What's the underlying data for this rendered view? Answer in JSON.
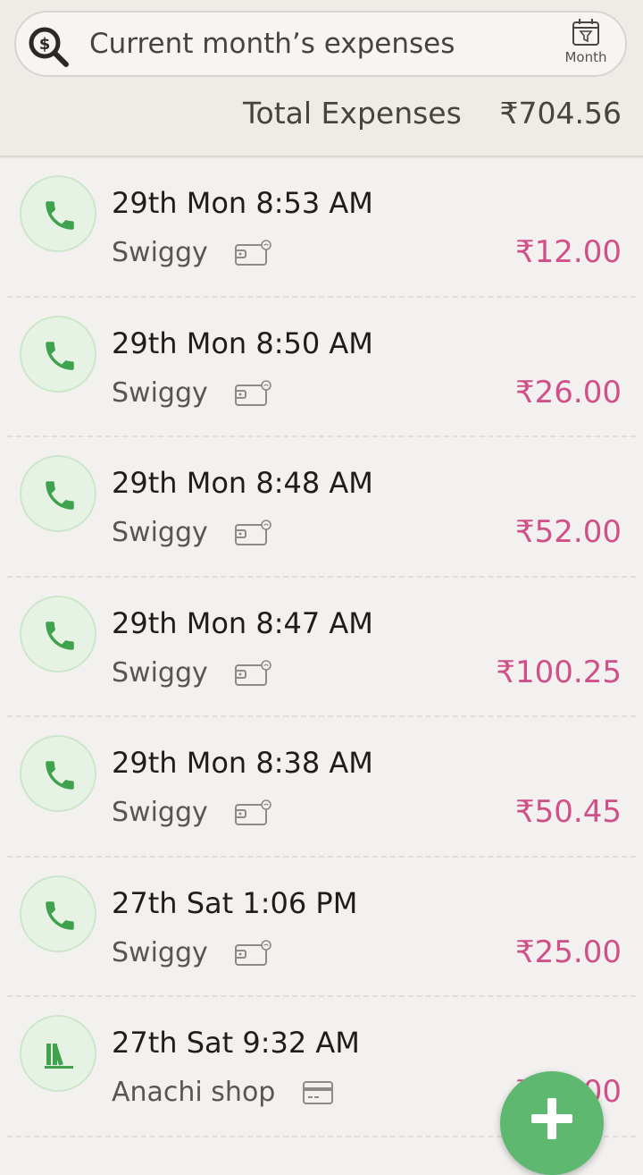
{
  "search": {
    "placeholder": "Current month’s expenses",
    "filter_label": "Month",
    "search_icon": "search-dollar-icon",
    "filter_icon": "calendar-filter-icon"
  },
  "summary": {
    "label": "Total Expenses",
    "value": "₹704.56"
  },
  "colors": {
    "amount": "#d0508a",
    "accent_green": "#3fa34d",
    "fab": "#5fb870"
  },
  "transactions": [
    {
      "time": "29th Mon 8:53 AM",
      "merchant": "Swiggy",
      "amount": "₹12.00",
      "category_icon": "phone-icon",
      "payment_icon": "wallet-icon"
    },
    {
      "time": "29th Mon 8:50 AM",
      "merchant": "Swiggy",
      "amount": "₹26.00",
      "category_icon": "phone-icon",
      "payment_icon": "wallet-icon"
    },
    {
      "time": "29th Mon 8:48 AM",
      "merchant": "Swiggy",
      "amount": "₹52.00",
      "category_icon": "phone-icon",
      "payment_icon": "wallet-icon"
    },
    {
      "time": "29th Mon 8:47 AM",
      "merchant": "Swiggy",
      "amount": "₹100.25",
      "category_icon": "phone-icon",
      "payment_icon": "wallet-icon"
    },
    {
      "time": "29th Mon 8:38 AM",
      "merchant": "Swiggy",
      "amount": "₹50.45",
      "category_icon": "phone-icon",
      "payment_icon": "wallet-icon"
    },
    {
      "time": "27th Sat 1:06 PM",
      "merchant": "Swiggy",
      "amount": "₹25.00",
      "category_icon": "phone-icon",
      "payment_icon": "wallet-icon"
    },
    {
      "time": "27th Sat 9:32 AM",
      "merchant": "Anachi shop",
      "amount": "₹15.00",
      "category_icon": "books-icon",
      "payment_icon": "card-icon"
    }
  ],
  "fab_icon": "plus-icon"
}
